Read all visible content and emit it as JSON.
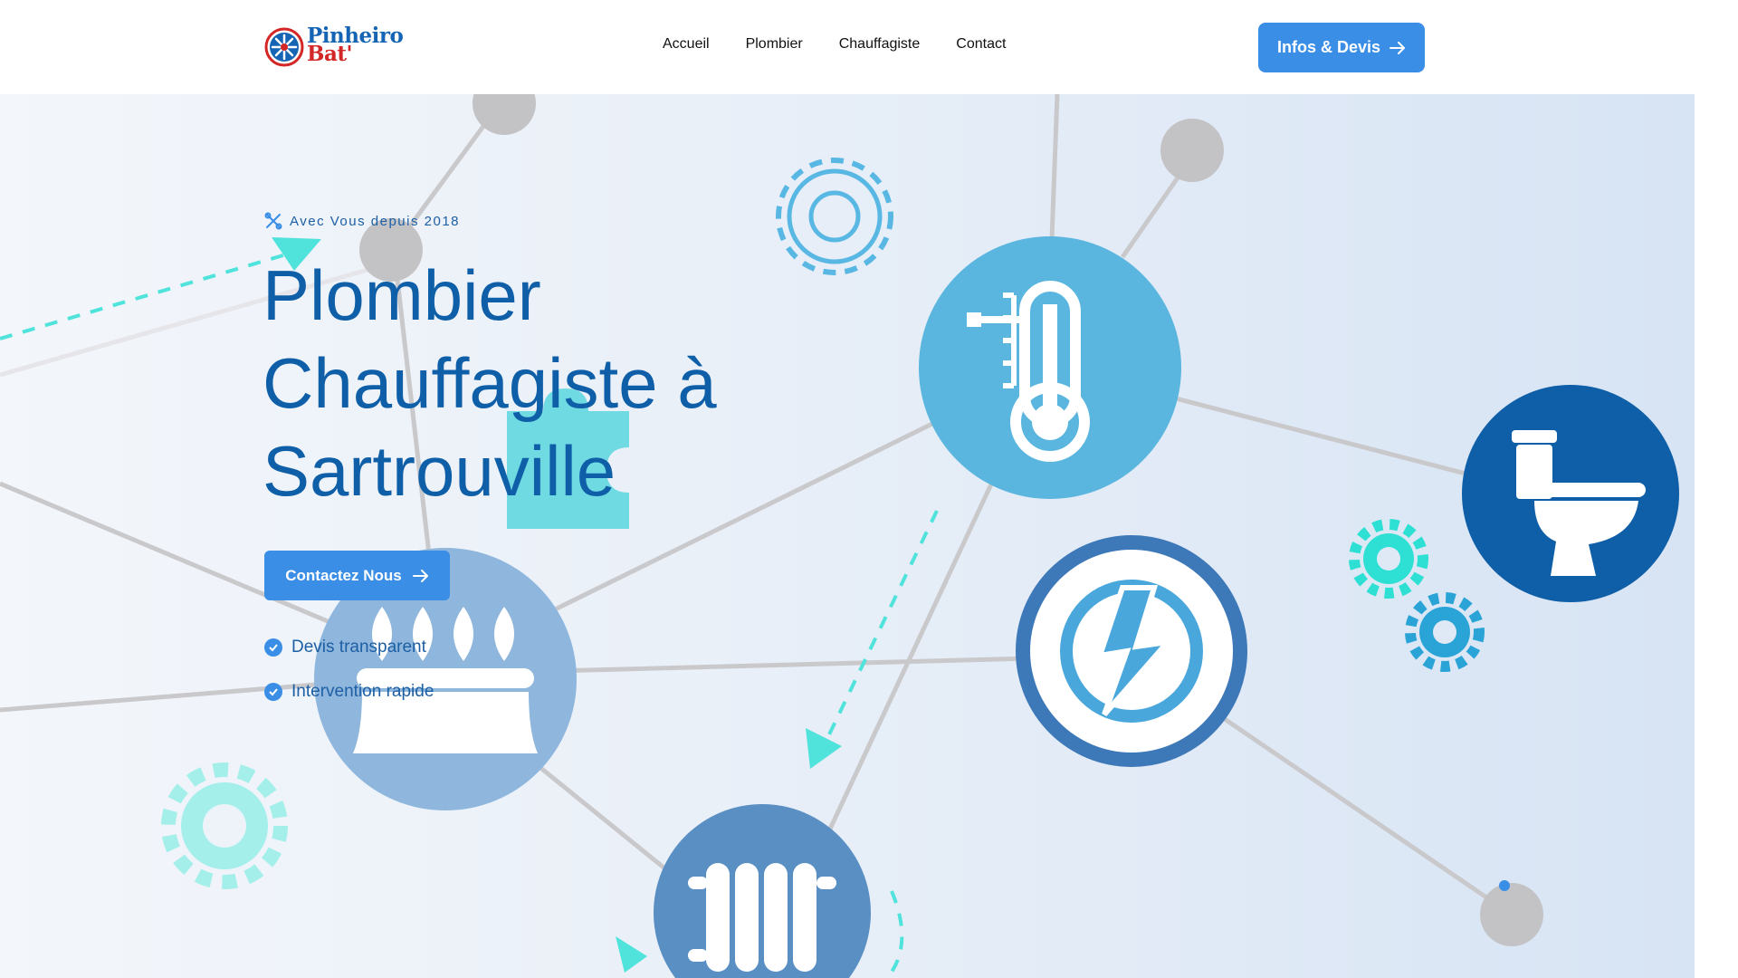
{
  "header": {
    "logo": {
      "line1": "Pinheiro",
      "line2": "Bat'"
    },
    "nav": [
      {
        "label": "Accueil"
      },
      {
        "label": "Plombier"
      },
      {
        "label": "Chauffagiste"
      },
      {
        "label": "Contact"
      }
    ],
    "cta_label": "Infos & Devis"
  },
  "hero": {
    "eyebrow": "Avec Vous depuis 2018",
    "title_lines": [
      "Plombier",
      "Chauffagiste à",
      "Sartrouville"
    ],
    "cta_label": "Contactez Nous",
    "features": [
      {
        "label": "Devis transparent"
      },
      {
        "label": "Intervention rapide"
      }
    ]
  },
  "colors": {
    "primary_blue": "#3a8ee6",
    "title_blue": "#0f5fa8",
    "logo_red": "#d32626",
    "teal_accent": "#2fe0d8"
  },
  "icons": [
    "gear-icon",
    "thermometer-icon",
    "toilet-icon",
    "lightning-icon",
    "gas-flame-icon",
    "radiator-icon",
    "arrow-right-icon",
    "check-icon",
    "tools-icon"
  ]
}
